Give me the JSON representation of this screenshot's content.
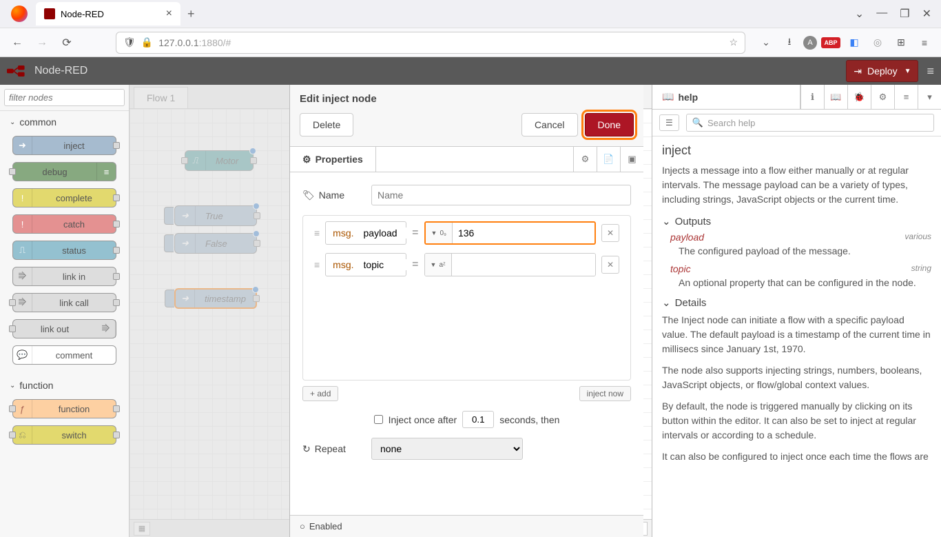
{
  "browser": {
    "tab_title": "Node-RED",
    "url_prefix": "127.0.0.1",
    "url_suffix": ":1880/#"
  },
  "header": {
    "app_title": "Node-RED",
    "deploy": "Deploy"
  },
  "palette": {
    "filter_placeholder": "filter nodes",
    "sections": {
      "common": "common",
      "function": "function"
    },
    "nodes": {
      "inject": "inject",
      "debug": "debug",
      "complete": "complete",
      "catch": "catch",
      "status": "status",
      "link_in": "link in",
      "link_call": "link call",
      "link_out": "link out",
      "comment": "comment",
      "function_": "function",
      "switch": "switch"
    }
  },
  "workspace": {
    "tab": "Flow 1",
    "nodes": {
      "motor": "Motor",
      "true_": "True",
      "false_": "False",
      "timestamp": "timestamp"
    }
  },
  "dialog": {
    "title": "Edit inject node",
    "delete": "Delete",
    "cancel": "Cancel",
    "done": "Done",
    "properties": "Properties",
    "name_label": "Name",
    "name_placeholder": "Name",
    "msg_prefix": "msg.",
    "payload": "payload",
    "payload_value": "136",
    "topic": "topic",
    "topic_value": "",
    "add": "add",
    "inject_now": "inject now",
    "inject_once": "Inject once after",
    "inject_once_sec": "0.1",
    "seconds_then": "seconds, then",
    "repeat": "Repeat",
    "repeat_value": "none",
    "enabled": "Enabled"
  },
  "help": {
    "title": "help",
    "search_placeholder": "Search help",
    "node_name": "inject",
    "intro": "Injects a message into a flow either manually or at regular intervals. The message payload can be a variety of types, including strings, JavaScript objects or the current time.",
    "outputs_title": "Outputs",
    "payload_name": "payload",
    "payload_type": "various",
    "payload_desc": "The configured payload of the message.",
    "topic_name": "topic",
    "topic_type": "string",
    "topic_desc": "An optional property that can be configured in the node.",
    "details_title": "Details",
    "details_1": "The Inject node can initiate a flow with a specific payload value. The default payload is a timestamp of the current time in millisecs since January 1st, 1970.",
    "details_2": "The node also supports injecting strings, numbers, booleans, JavaScript objects, or flow/global context values.",
    "details_3": "By default, the node is triggered manually by clicking on its button within the editor. It can also be set to inject at regular intervals or according to a schedule.",
    "details_4": "It can also be configured to inject once each time the flows are"
  }
}
